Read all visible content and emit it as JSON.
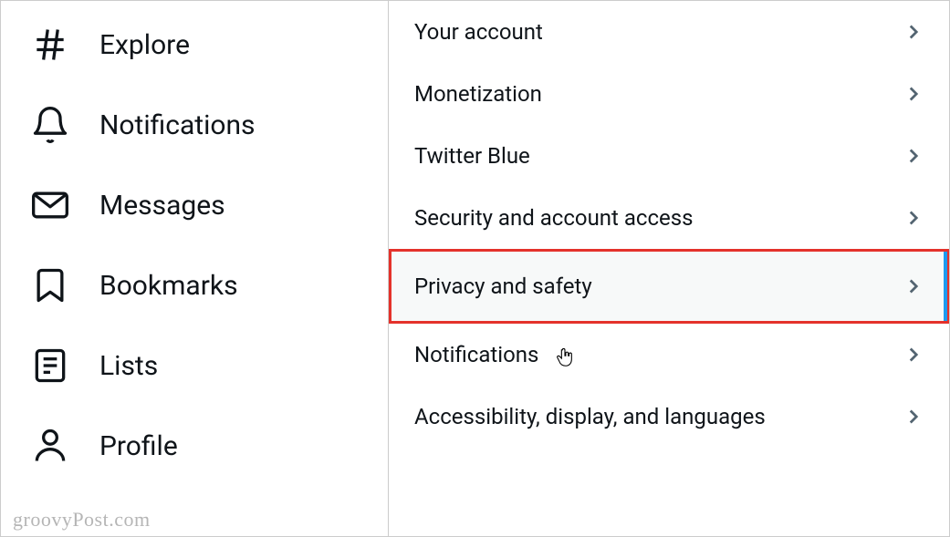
{
  "sidebar": {
    "items": [
      {
        "label": "Explore",
        "icon": "hash"
      },
      {
        "label": "Notifications",
        "icon": "bell"
      },
      {
        "label": "Messages",
        "icon": "envelope"
      },
      {
        "label": "Bookmarks",
        "icon": "bookmark"
      },
      {
        "label": "Lists",
        "icon": "list"
      },
      {
        "label": "Profile",
        "icon": "person"
      }
    ]
  },
  "settings": {
    "items": [
      {
        "label": "Your account"
      },
      {
        "label": "Monetization"
      },
      {
        "label": "Twitter Blue"
      },
      {
        "label": "Security and account access"
      },
      {
        "label": "Privacy and safety",
        "active": true
      },
      {
        "label": "Notifications"
      },
      {
        "label": "Accessibility, display, and languages"
      }
    ]
  },
  "watermark": "groovyPost.com"
}
